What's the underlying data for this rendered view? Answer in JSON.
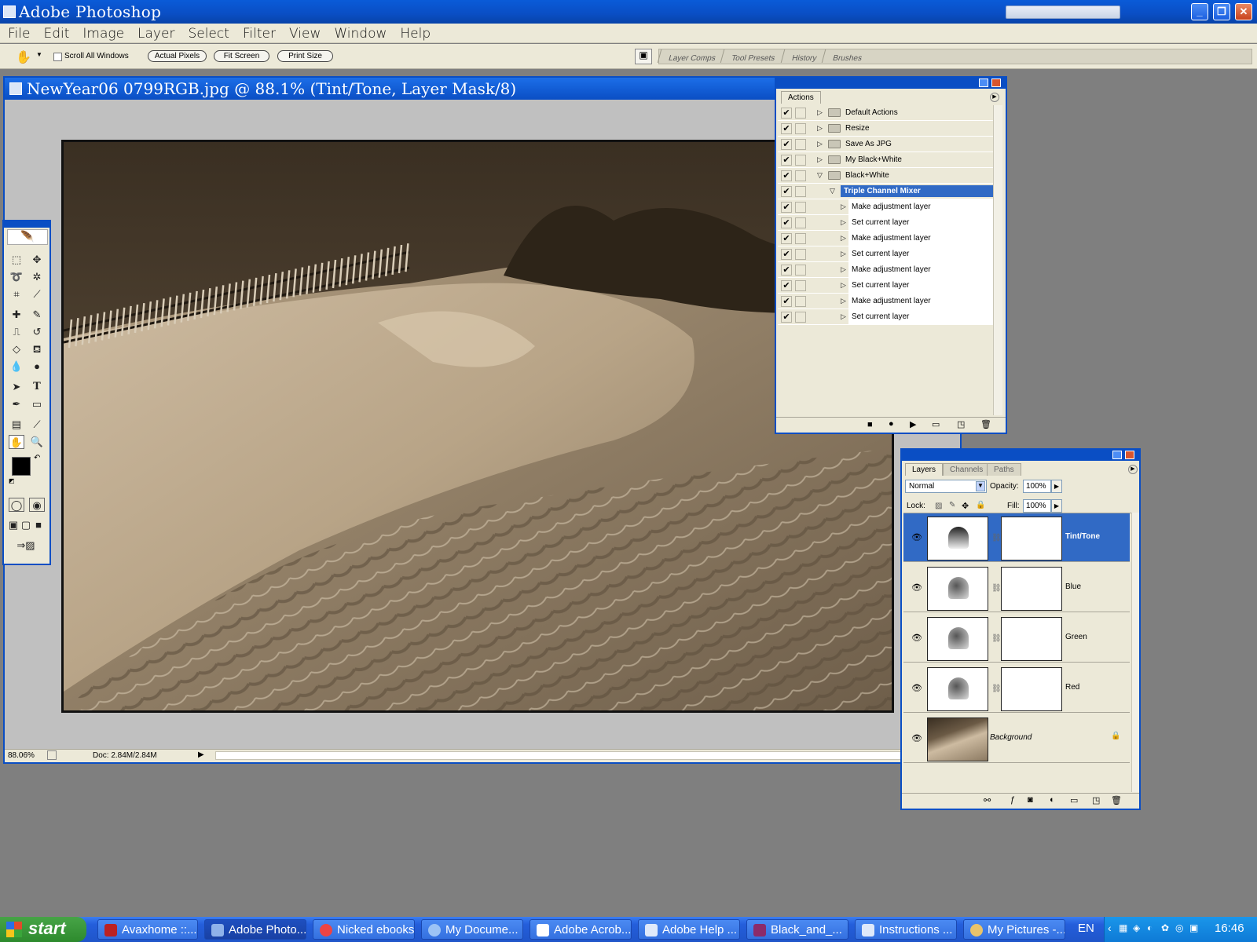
{
  "window": {
    "title": "Adobe Photoshop"
  },
  "menu": [
    "File",
    "Edit",
    "Image",
    "Layer",
    "Select",
    "Filter",
    "View",
    "Window",
    "Help"
  ],
  "options": {
    "scroll_all_windows": "Scroll All Windows",
    "actual_pixels": "Actual Pixels",
    "fit_screen": "Fit Screen",
    "print_size": "Print Size",
    "palette_well_tabs": [
      "Layer Comps",
      "Tool Presets",
      "History",
      "Brushes"
    ]
  },
  "document": {
    "title": "NewYear06  0799RGB.jpg @ 88.1% (Tint/Tone, Layer Mask/8)",
    "zoom": "88.06%",
    "doc_size": "Doc: 2.84M/2.84M"
  },
  "actions_panel": {
    "tab": "Actions",
    "rows": [
      {
        "label": "Default Actions",
        "level": 0,
        "expanded": false
      },
      {
        "label": "Resize",
        "level": 0,
        "expanded": false
      },
      {
        "label": "Save As JPG",
        "level": 0,
        "expanded": false
      },
      {
        "label": "My Black+White",
        "level": 0,
        "expanded": false
      },
      {
        "label": "Black+White",
        "level": 0,
        "expanded": true
      },
      {
        "label": "Triple Channel Mixer",
        "level": 1,
        "expanded": true,
        "selected": true
      },
      {
        "label": "Make adjustment layer",
        "level": 2
      },
      {
        "label": "Set current layer",
        "level": 2
      },
      {
        "label": "Make adjustment layer",
        "level": 2
      },
      {
        "label": "Set current layer",
        "level": 2
      },
      {
        "label": "Make adjustment layer",
        "level": 2
      },
      {
        "label": "Set current layer",
        "level": 2
      },
      {
        "label": "Make adjustment layer",
        "level": 2
      },
      {
        "label": "Set current layer",
        "level": 2
      }
    ]
  },
  "layers_panel": {
    "tabs": [
      "Layers",
      "Channels",
      "Paths"
    ],
    "blend_mode": "Normal",
    "opacity_label": "Opacity:",
    "opacity": "100%",
    "lock_label": "Lock:",
    "fill_label": "Fill:",
    "fill": "100%",
    "layers": [
      {
        "name": "Tint/Tone",
        "selected": true
      },
      {
        "name": "Blue"
      },
      {
        "name": "Green"
      },
      {
        "name": "Red"
      },
      {
        "name": "Background",
        "locked": true
      }
    ]
  },
  "taskbar": {
    "start": "start",
    "tasks": [
      "Avaxhome ::...",
      "Adobe Photo...",
      "Nicked ebooks",
      "My Docume...",
      "Adobe Acrob...",
      "Adobe Help ...",
      "Black_and_...",
      "Instructions ...",
      "My Pictures -..."
    ],
    "language": "EN",
    "clock": "16:46"
  }
}
